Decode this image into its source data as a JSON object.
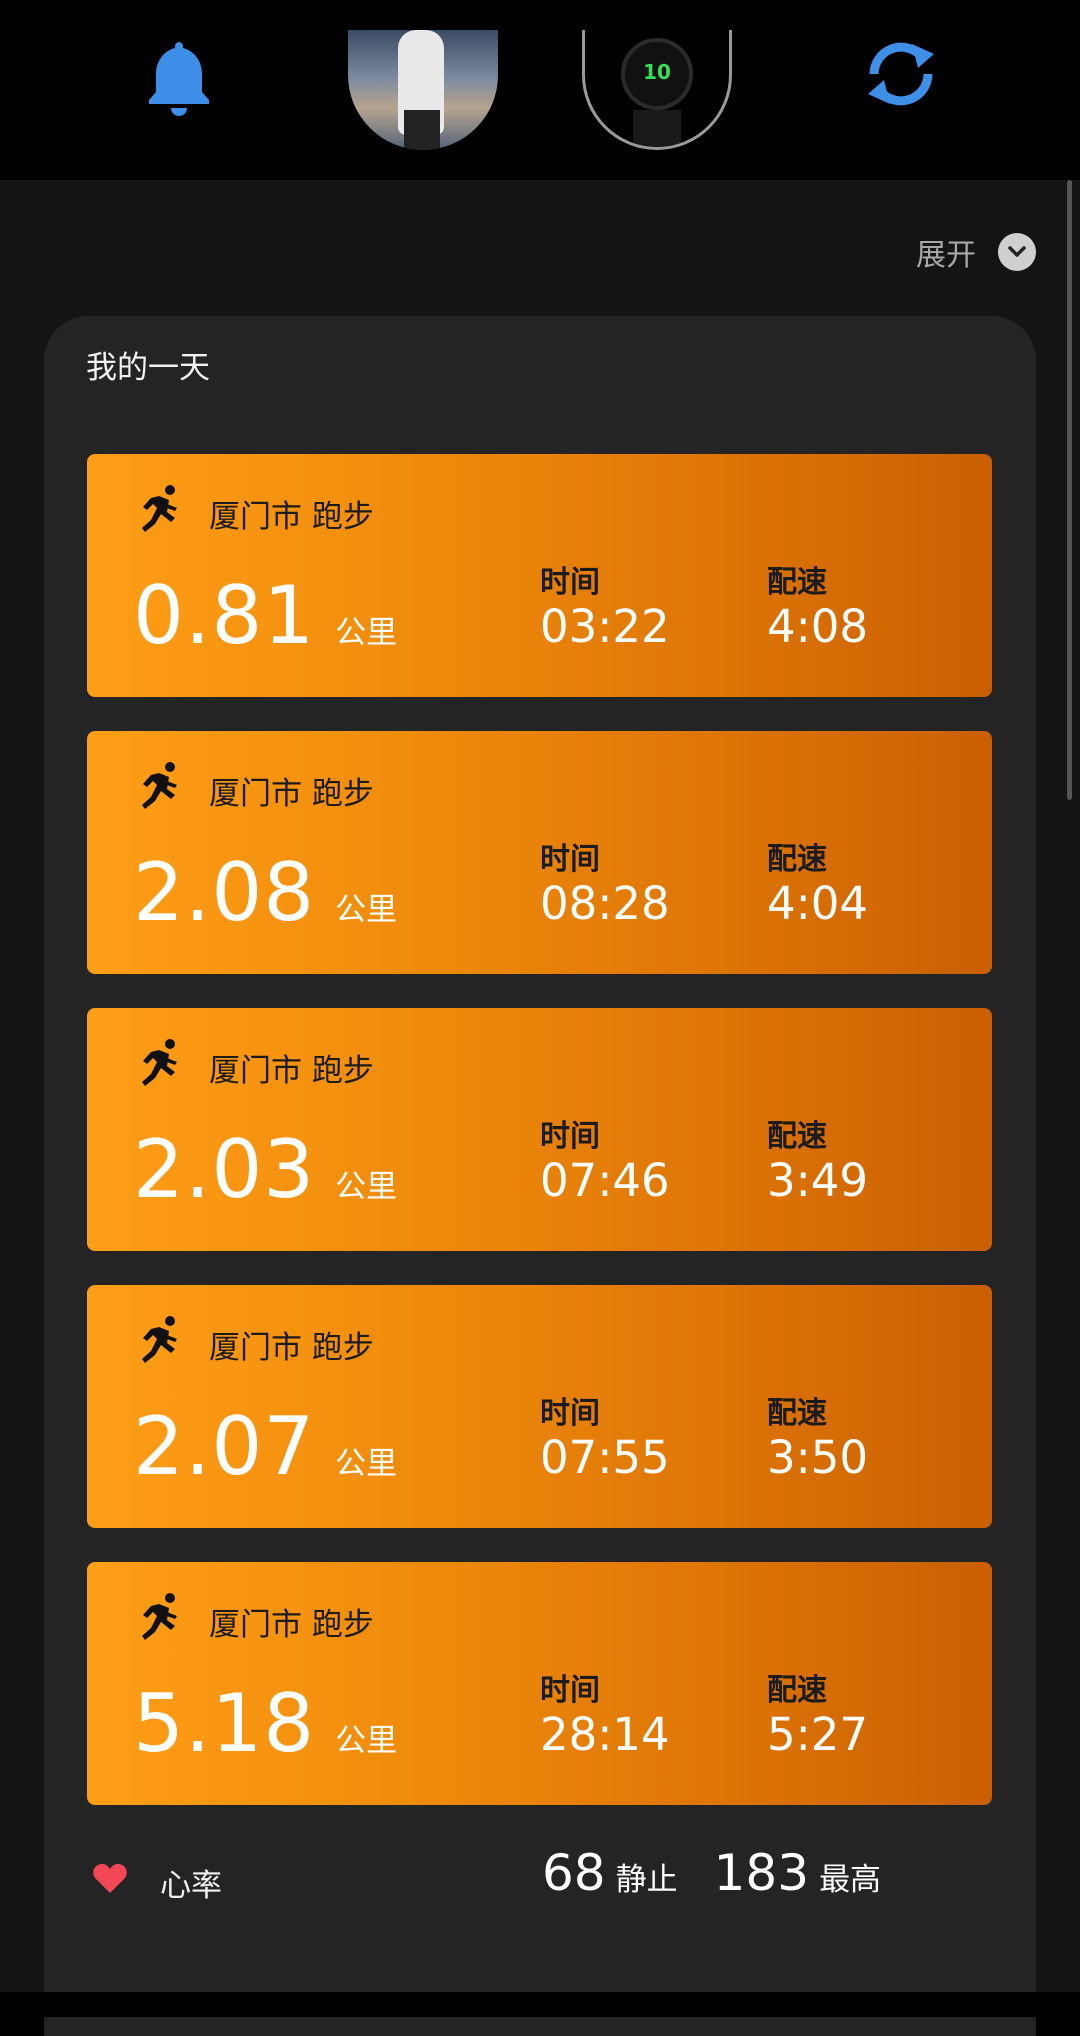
{
  "header": {
    "bell_icon": "bell-icon",
    "sync_icon": "sync-icon",
    "watch_face_value": "10",
    "accent_color": "#3d8fe8"
  },
  "toolbar": {
    "expand_label": "展开"
  },
  "panel": {
    "title": "我的一天",
    "activities": [
      {
        "location": "厦门市 跑步",
        "distance": "0.81",
        "unit": "公里",
        "time_label": "时间",
        "time": "03:22",
        "pace_label": "配速",
        "pace": "4:08"
      },
      {
        "location": "厦门市 跑步",
        "distance": "2.08",
        "unit": "公里",
        "time_label": "时间",
        "time": "08:28",
        "pace_label": "配速",
        "pace": "4:04"
      },
      {
        "location": "厦门市 跑步",
        "distance": "2.03",
        "unit": "公里",
        "time_label": "时间",
        "time": "07:46",
        "pace_label": "配速",
        "pace": "3:49"
      },
      {
        "location": "厦门市 跑步",
        "distance": "2.07",
        "unit": "公里",
        "time_label": "时间",
        "time": "07:55",
        "pace_label": "配速",
        "pace": "3:50"
      },
      {
        "location": "厦门市 跑步",
        "distance": "5.18",
        "unit": "公里",
        "time_label": "时间",
        "time": "28:14",
        "pace_label": "配速",
        "pace": "5:27"
      }
    ],
    "heart_rate": {
      "label": "心率",
      "resting_value": "68",
      "resting_label": "静止",
      "max_value": "183",
      "max_label": "最高"
    }
  }
}
